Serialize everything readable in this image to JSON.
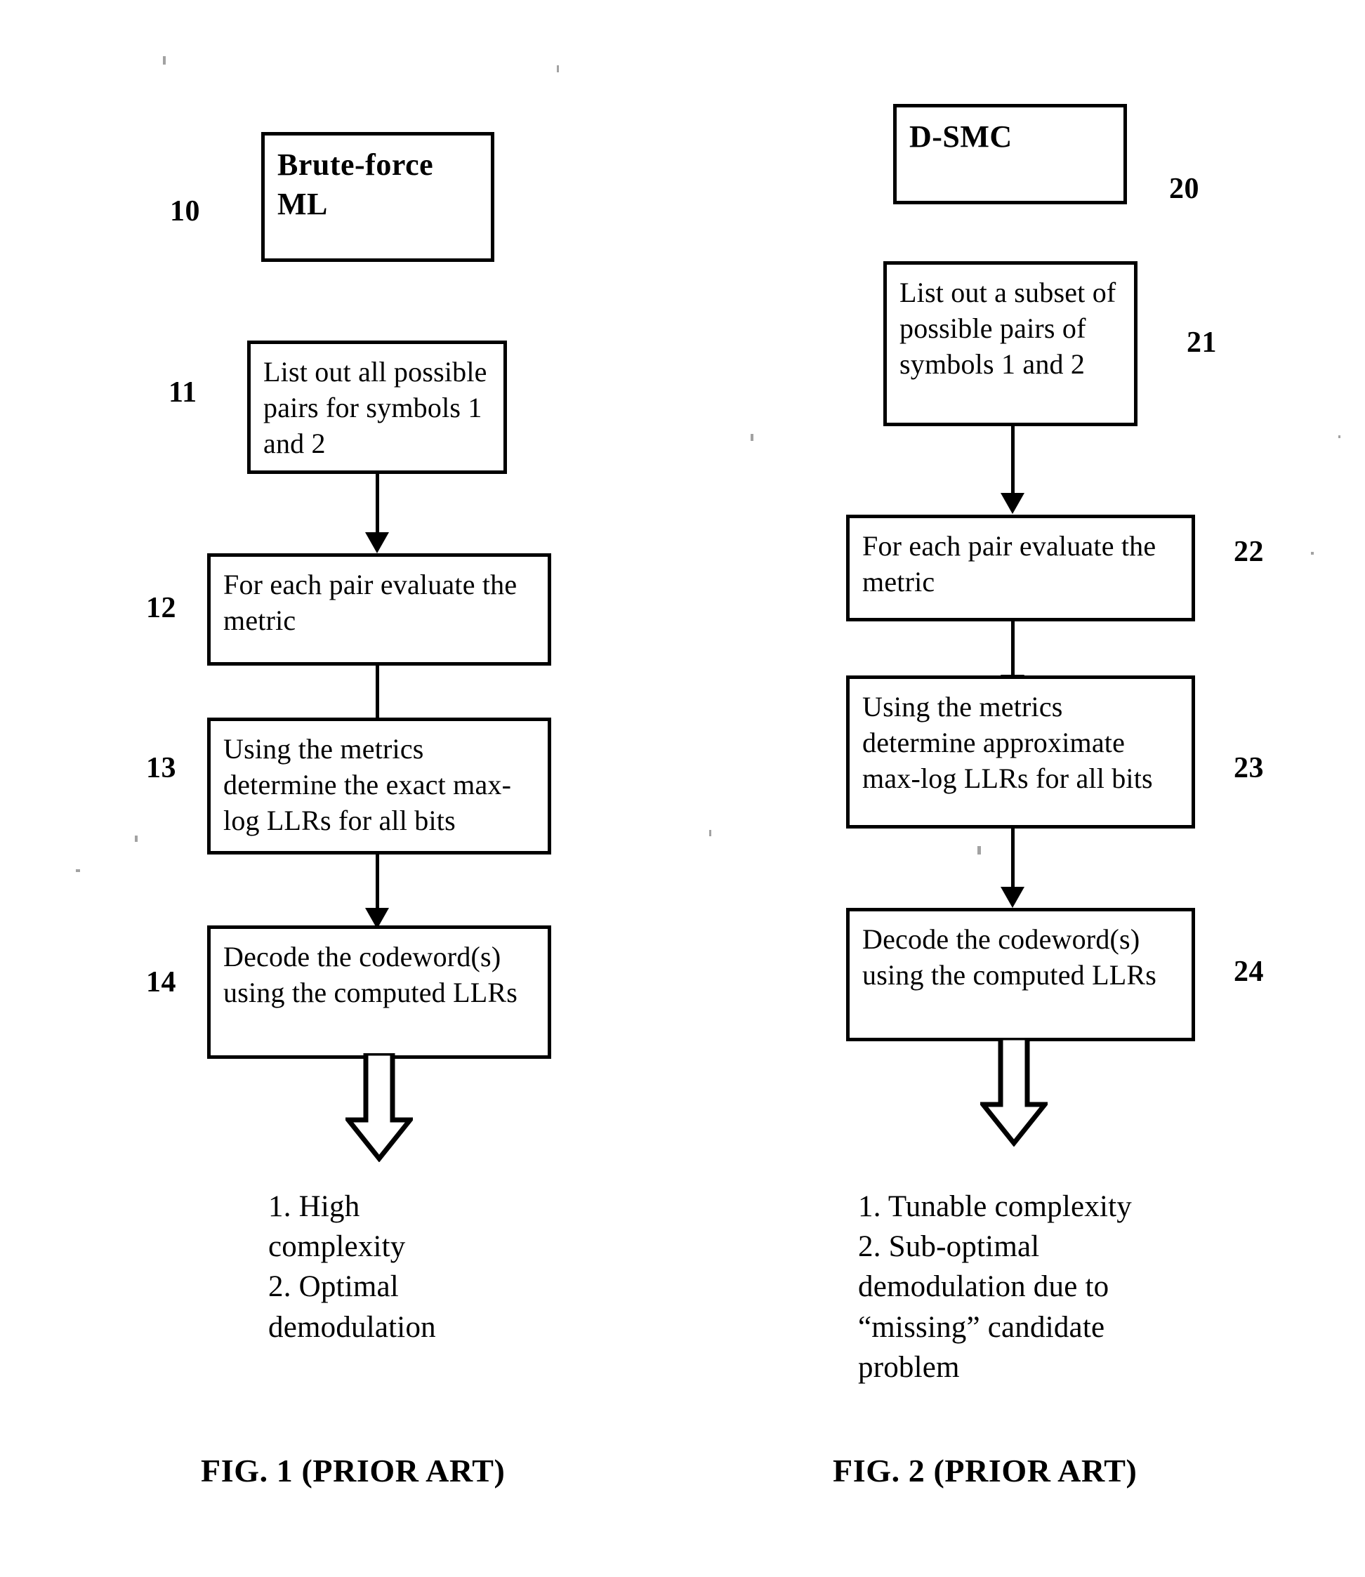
{
  "document": {
    "type": "patent-figure-sheet",
    "background_color": "#ffffff",
    "ink_color": "#000000"
  },
  "figures": [
    {
      "id": "fig1",
      "caption": "FIG. 1 (PRIOR ART)",
      "title_box": {
        "ref": "10",
        "text": "Brute-force ML"
      },
      "steps": [
        {
          "ref": "11",
          "text": "List out all possible pairs for symbols 1 and 2"
        },
        {
          "ref": "12",
          "text": "For each  pair  evaluate the metric"
        },
        {
          "ref": "13",
          "text": "Using the metrics determine the exact max-log LLRs for all bits"
        },
        {
          "ref": "14",
          "text": "Decode the codeword(s) using the computed LLRs"
        }
      ],
      "outcome": "1. High\ncomplexity\n2. Optimal\ndemodulation"
    },
    {
      "id": "fig2",
      "caption": "FIG. 2 (PRIOR ART)",
      "title_box": {
        "ref": "20",
        "text": "D-SMC"
      },
      "steps": [
        {
          "ref": "21",
          "text": "List out a subset of possible pairs of symbols 1 and 2"
        },
        {
          "ref": "22",
          "text": "For each  pair  evaluate the metric"
        },
        {
          "ref": "23",
          "text": "Using the metrics determine approximate max-log LLRs for all bits"
        },
        {
          "ref": "24",
          "text": "Decode the codeword(s) using the computed LLRs"
        }
      ],
      "outcome": "1. Tunable complexity\n2. Sub-optimal\ndemodulation due to\n“missing” candidate\nproblem"
    }
  ]
}
